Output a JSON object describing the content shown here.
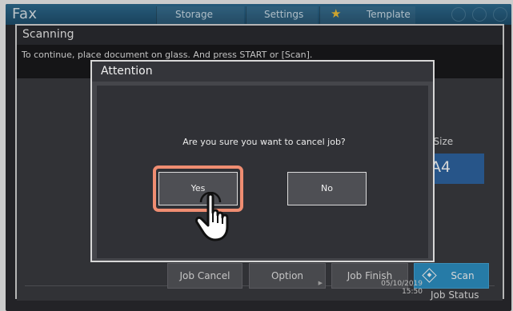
{
  "topbar": {
    "app_title": "Fax",
    "tabs": [
      "Storage",
      "Settings",
      "Template"
    ],
    "icons": [
      "star-icon",
      "home-icon",
      "globe-icon",
      "help-icon"
    ],
    "star_color": "#f6c12b"
  },
  "panel": {
    "title": "Scanning",
    "message": "To continue, place document on glass. And press START or [Scan].",
    "original_size_label": "al Size",
    "original_size_value": "A4"
  },
  "function_bar": {
    "job_cancel": "Job Cancel",
    "option": "Option",
    "job_finish": "Job Finish",
    "scan": "Scan",
    "scan_color": "#2e93c8"
  },
  "status_bar": {
    "date": "05/10/2019",
    "time": "15:50",
    "job_status": "Job Status"
  },
  "dialog": {
    "title": "Attention",
    "question": "Are you sure you want to cancel job?",
    "yes_label": "Yes",
    "no_label": "No",
    "highlight_color": "#ef8d72"
  },
  "pointer": {
    "icon": "hand-pointer-icon"
  }
}
